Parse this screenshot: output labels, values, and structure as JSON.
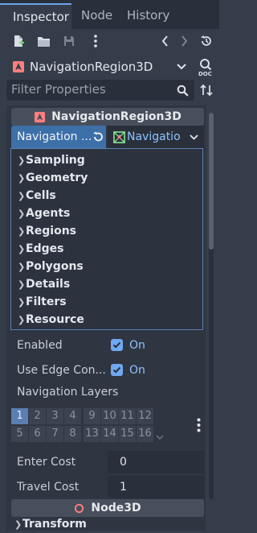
{
  "tabs": [
    {
      "label": "Inspector"
    },
    {
      "label": "Node"
    },
    {
      "label": "History"
    }
  ],
  "object": {
    "name": "NavigationRegion3D"
  },
  "filter": {
    "placeholder": "Filter Properties"
  },
  "section_title": "NavigationRegion3D",
  "resource": {
    "button_label": "Navigation ...",
    "picker_label": "Navigatio",
    "items": [
      {
        "label": "Sampling"
      },
      {
        "label": "Geometry"
      },
      {
        "label": "Cells"
      },
      {
        "label": "Agents"
      },
      {
        "label": "Regions"
      },
      {
        "label": "Edges"
      },
      {
        "label": "Polygons"
      },
      {
        "label": "Details"
      },
      {
        "label": "Filters"
      },
      {
        "label": "Resource"
      }
    ]
  },
  "props": {
    "enabled": {
      "label": "Enabled",
      "value": "On",
      "checked": true
    },
    "use_edge": {
      "label": "Use Edge Con...",
      "value": "On",
      "checked": true
    },
    "nav_layers": {
      "label": "Navigation Layers"
    },
    "enter_cost": {
      "label": "Enter Cost",
      "value": "0"
    },
    "travel_cost": {
      "label": "Travel Cost",
      "value": "1"
    }
  },
  "layers": {
    "row1": [
      "1",
      "2",
      "3",
      "4",
      "9",
      "10",
      "11",
      "12"
    ],
    "row2": [
      "5",
      "6",
      "7",
      "8",
      "13",
      "14",
      "15",
      "16"
    ],
    "active": [
      "1"
    ]
  },
  "node3d_title": "Node3D",
  "transform_label": "Transform",
  "colors": {
    "accent": "#6fa8f0",
    "background": "#363d4a",
    "panel": "#2f3541",
    "selected": "#3d6fa8"
  }
}
